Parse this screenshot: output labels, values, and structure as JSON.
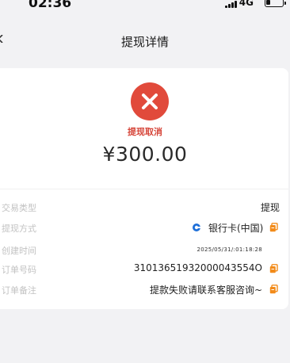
{
  "status_bar": {
    "time": "02:36",
    "network": "4G"
  },
  "nav": {
    "title": "提现详情"
  },
  "result": {
    "status_text": "提现取消",
    "amount": "¥300.00"
  },
  "details": {
    "rows": [
      {
        "label": "交易类型",
        "value": "提现"
      },
      {
        "label": "提现方式",
        "value": "银行卡(中国)"
      },
      {
        "label": "创建时间",
        "value": "2025/05/31/:01:18:28"
      },
      {
        "label": "订单号码",
        "value": "31013651932000043554O"
      },
      {
        "label": "订单备注",
        "value": "提款失败请联系客服咨询~"
      }
    ]
  },
  "colors": {
    "error_red": "#e14a3b",
    "copy_orange": "#f28b1a",
    "bank_blue": "#1e6fd8"
  }
}
